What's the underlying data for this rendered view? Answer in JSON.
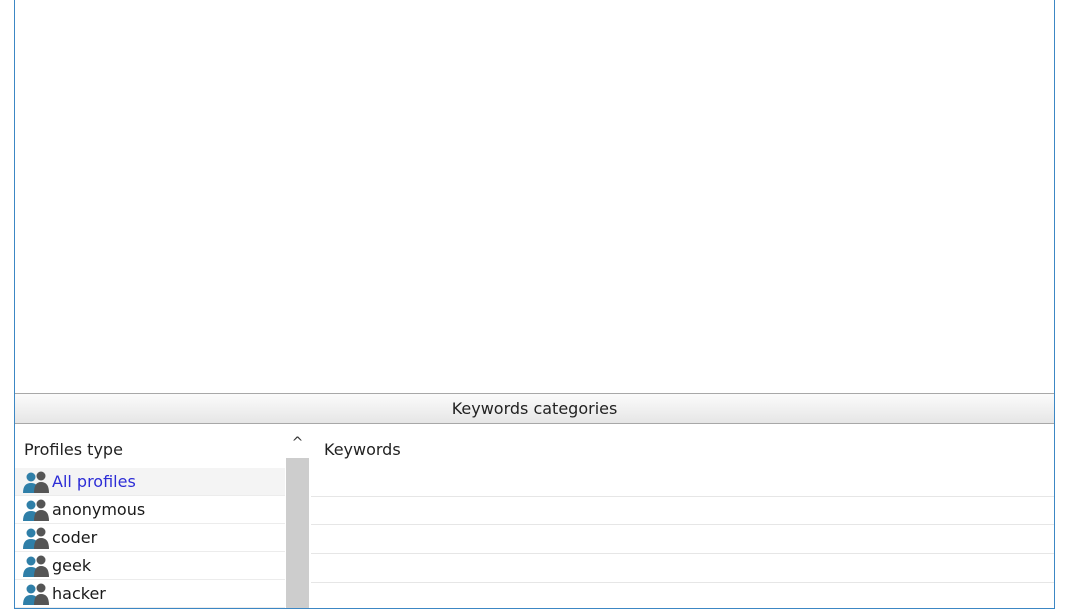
{
  "section_header": "Keywords categories",
  "profiles_panel": {
    "title": "Profiles type",
    "items": [
      {
        "label": "All profiles",
        "icon": "users-icon",
        "selected": true
      },
      {
        "label": "anonymous",
        "icon": "users-icon"
      },
      {
        "label": "coder",
        "icon": "users-icon"
      },
      {
        "label": "geek",
        "icon": "users-icon"
      },
      {
        "label": "hacker",
        "icon": "users-icon"
      }
    ]
  },
  "scroll_up_glyph": "^",
  "keywords_panel": {
    "title": "Keywords"
  },
  "colors": {
    "frame_border": "#3c87c4",
    "selected_text": "#2d2dd6",
    "icon_primary": "#2f7fa8",
    "icon_secondary": "#555555"
  }
}
